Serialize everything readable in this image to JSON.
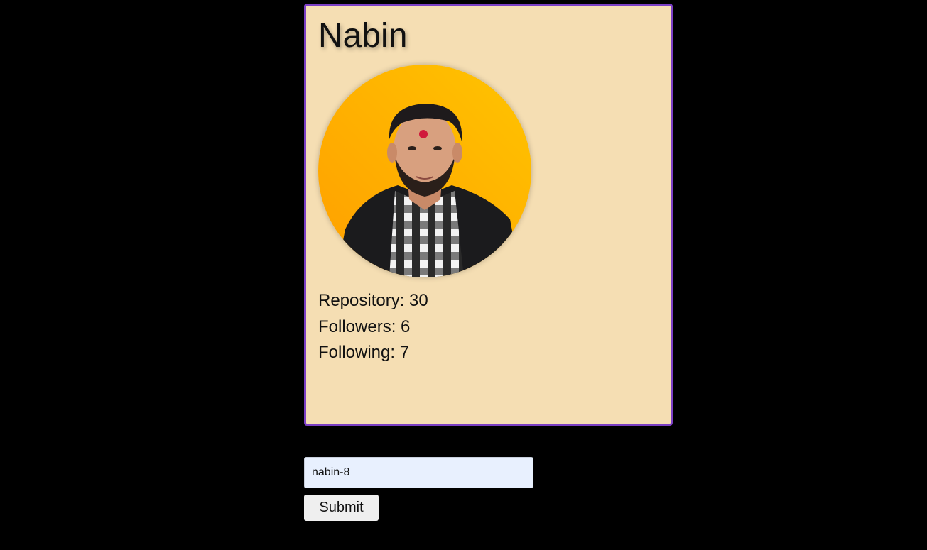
{
  "profile": {
    "name": "Nabin",
    "avatar_icon": "profile-photo",
    "stats": {
      "repository_label": "Repository: 30",
      "followers_label": "Followers: 6",
      "following_label": "Following: 7"
    }
  },
  "search": {
    "value": "nabin-8",
    "submit_label": "Submit"
  },
  "colors": {
    "page_background": "#000000",
    "card_background": "#f5deb3",
    "card_border": "#7b3fc4",
    "avatar_gradient_start": "#ff9f00",
    "avatar_gradient_end": "#ffc400",
    "input_background": "#e8f0fe"
  }
}
